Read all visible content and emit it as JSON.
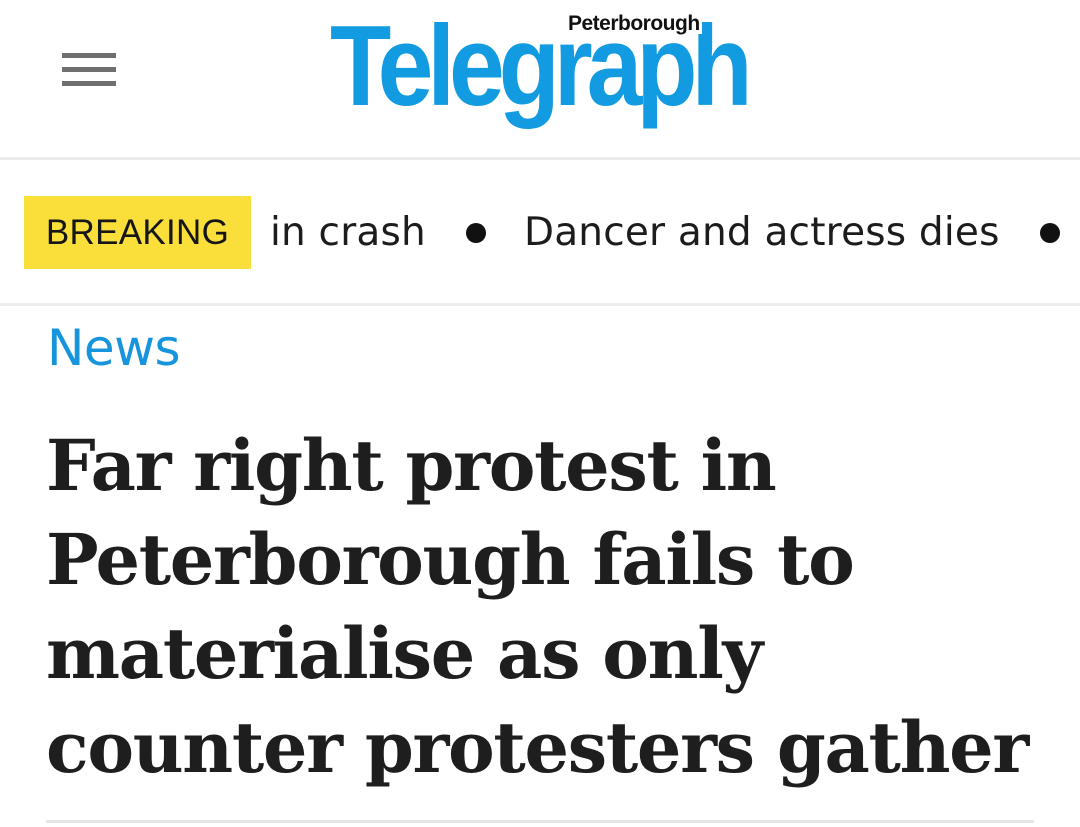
{
  "header": {
    "logo_main": "Telegraph",
    "logo_sub": "Peterborough",
    "brand_color": "#129be0",
    "menu_icon": "hamburger-menu-icon"
  },
  "ticker": {
    "badge_label": "BREAKING",
    "badge_color": "#fadf3b",
    "items": [
      "in crash",
      "Dancer and actress dies"
    ]
  },
  "article": {
    "section": "News",
    "section_color": "#1694dc",
    "headline": "Far right protest in Peterborough fails to materialise as only counter protesters gather"
  }
}
